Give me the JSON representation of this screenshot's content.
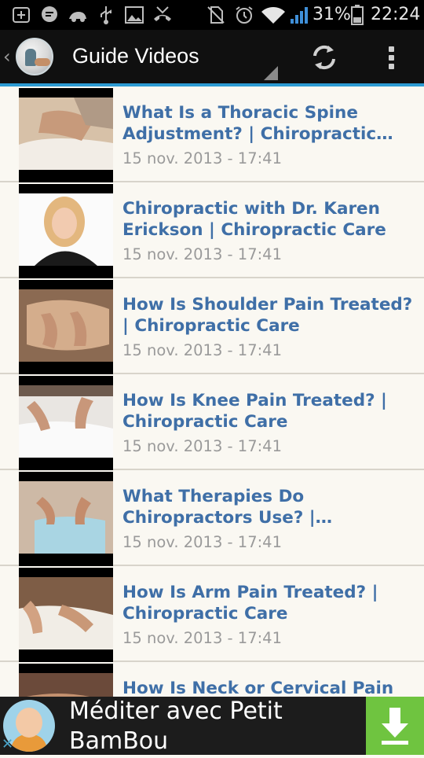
{
  "status_bar": {
    "battery_percent": "31%",
    "time": "22:24",
    "icons": [
      "notification-plus-icon",
      "chat-icon",
      "car-icon",
      "usb-icon",
      "image-icon",
      "missed-call-icon",
      "no-sim-icon",
      "alarm-icon",
      "wifi-icon",
      "signal-icon",
      "battery-icon"
    ]
  },
  "action_bar": {
    "title": "Guide Videos",
    "icons": [
      "back-icon",
      "app-logo",
      "spinner-icon",
      "refresh-icon",
      "overflow-menu-icon"
    ]
  },
  "colors": {
    "accent": "#2c9bd3",
    "title_text": "#3f6fa7",
    "date_text": "#9a9a9a",
    "list_bg": "#faf8f2",
    "ad_download": "#6fc440"
  },
  "videos": [
    {
      "title": "What Is a Thoracic Spine Adjustment? | Chiropractic Care",
      "date": "15 nov. 2013 - 17:41"
    },
    {
      "title": "Chiropractic with Dr. Karen Erickson | Chiropractic Care",
      "date": "15 nov. 2013 - 17:41"
    },
    {
      "title": "How Is Shoulder Pain Treated? | Chiropractic Care",
      "date": "15 nov. 2013 - 17:41"
    },
    {
      "title": "How Is Knee Pain Treated? | Chiropractic Care",
      "date": "15 nov. 2013 - 17:41"
    },
    {
      "title": "What Therapies Do Chiropractors Use? | Chiropract…",
      "date": "15 nov. 2013 - 17:41"
    },
    {
      "title": "How Is Arm Pain Treated? | Chiropractic Care",
      "date": "15 nov. 2013 - 17:41"
    },
    {
      "title": "How Is Neck or Cervical Pain",
      "date": ""
    }
  ],
  "ad": {
    "text": "Méditer avec Petit BamBou",
    "icons": [
      "ad-avatar",
      "ad-close-icon",
      "download-icon"
    ]
  }
}
